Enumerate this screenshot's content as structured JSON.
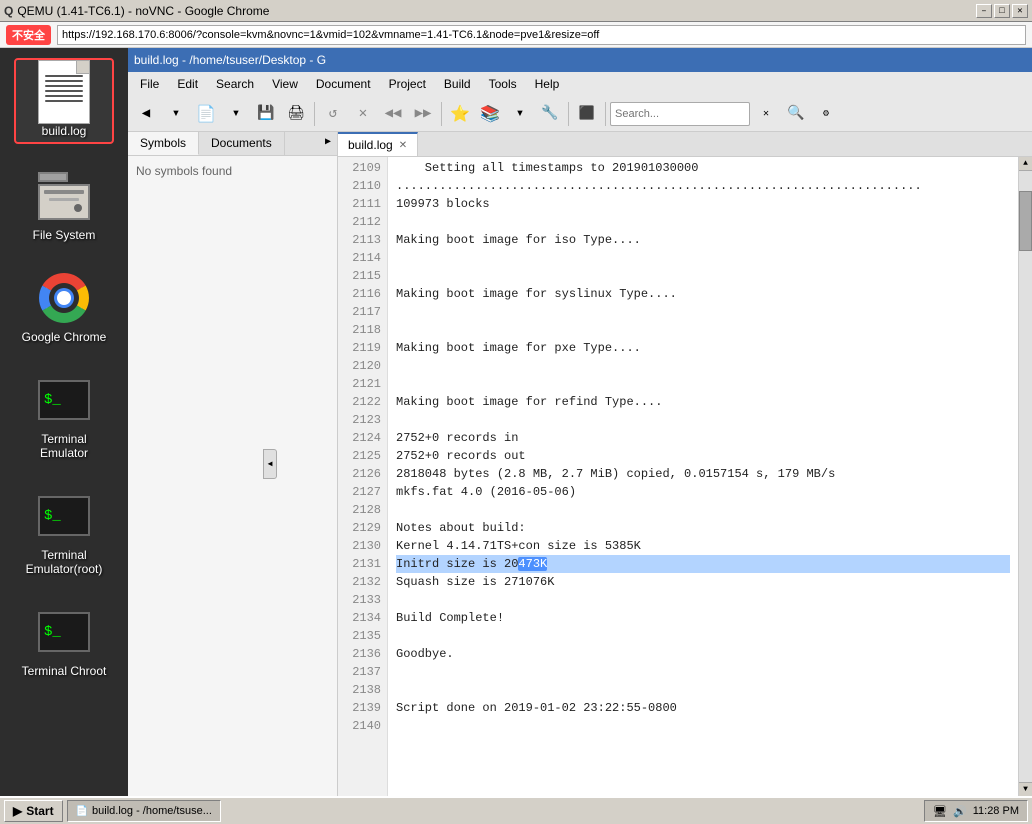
{
  "titlebar": {
    "title": "QEMU (1.41-TC6.1) - noVNC - Google Chrome",
    "icon": "Q",
    "minimize": "–",
    "maximize": "□",
    "close": "✕"
  },
  "security": {
    "warning_text": "不安全",
    "url": "https://192.168.170.6:8006/?console=kvm&novnc=1&vmid=102&vmname=1.41-TC6.1&node=pve1&resize=off"
  },
  "gedit": {
    "title": "build.log - /home/tsuser/Desktop - G",
    "menus": [
      "File",
      "Edit",
      "Search",
      "View",
      "Document",
      "Project",
      "Build",
      "Tools",
      "Help"
    ],
    "tab_name": "build.log"
  },
  "panels": {
    "left_tabs": [
      "Symbols",
      "Documents"
    ],
    "symbols_text": "No symbols found"
  },
  "log_lines": [
    {
      "num": "2109",
      "text": "    Setting all timestamps to 201901030000"
    },
    {
      "num": "2110",
      "text": "........................................................................."
    },
    {
      "num": "2111",
      "text": "109973 blocks"
    },
    {
      "num": "2112",
      "text": ""
    },
    {
      "num": "2113",
      "text": "Making boot image for iso Type...."
    },
    {
      "num": "2114",
      "text": ""
    },
    {
      "num": "2115",
      "text": ""
    },
    {
      "num": "2116",
      "text": "Making boot image for syslinux Type...."
    },
    {
      "num": "2117",
      "text": ""
    },
    {
      "num": "2118",
      "text": ""
    },
    {
      "num": "2119",
      "text": "Making boot image for pxe Type...."
    },
    {
      "num": "2120",
      "text": ""
    },
    {
      "num": "2121",
      "text": ""
    },
    {
      "num": "2122",
      "text": "Making boot image for refind Type...."
    },
    {
      "num": "2123",
      "text": ""
    },
    {
      "num": "2124",
      "text": "2752+0 records in"
    },
    {
      "num": "2125",
      "text": "2752+0 records out"
    },
    {
      "num": "2126",
      "text": "2818048 bytes (2.8 MB, 2.7 MiB) copied, 0.0157154 s, 179 MB/s"
    },
    {
      "num": "2127",
      "text": "mkfs.fat 4.0 (2016-05-06)"
    },
    {
      "num": "2128",
      "text": ""
    },
    {
      "num": "2129",
      "text": "Notes about build:"
    },
    {
      "num": "2130",
      "text": "Kernel 4.14.71TS+con size is 5385K"
    },
    {
      "num": "2131",
      "text": "Initrd size is 20473K",
      "highlight": {
        "start": 17,
        "end": 22,
        "text": "20473K"
      }
    },
    {
      "num": "2132",
      "text": "Squash size is 271076K"
    },
    {
      "num": "2133",
      "text": ""
    },
    {
      "num": "2134",
      "text": "Build Complete!"
    },
    {
      "num": "2135",
      "text": ""
    },
    {
      "num": "2136",
      "text": "Goodbye."
    },
    {
      "num": "2137",
      "text": ""
    },
    {
      "num": "2138",
      "text": ""
    },
    {
      "num": "2139",
      "text": "Script done on 2019-01-02 23:22:55-0800"
    },
    {
      "num": "2140",
      "text": ""
    }
  ],
  "desktop_icons": [
    {
      "id": "build-log",
      "label": "build.log",
      "type": "document",
      "selected": true
    },
    {
      "id": "file-system",
      "label": "File System",
      "type": "filesystem"
    },
    {
      "id": "google-chrome",
      "label": "Google Chrome",
      "type": "chrome"
    },
    {
      "id": "terminal-emulator",
      "label": "Terminal Emulator",
      "type": "terminal"
    },
    {
      "id": "terminal-emulator-root",
      "label": "Terminal Emulator(root)",
      "type": "terminal"
    },
    {
      "id": "terminal-chroot",
      "label": "Terminal Chroot",
      "type": "terminal"
    }
  ],
  "taskbar": {
    "start_label": "Start",
    "task_label": "build.log - /home/tsuse...",
    "time": "11:28 PM",
    "volume_icon": "🔊",
    "network_icon": "🖥"
  }
}
